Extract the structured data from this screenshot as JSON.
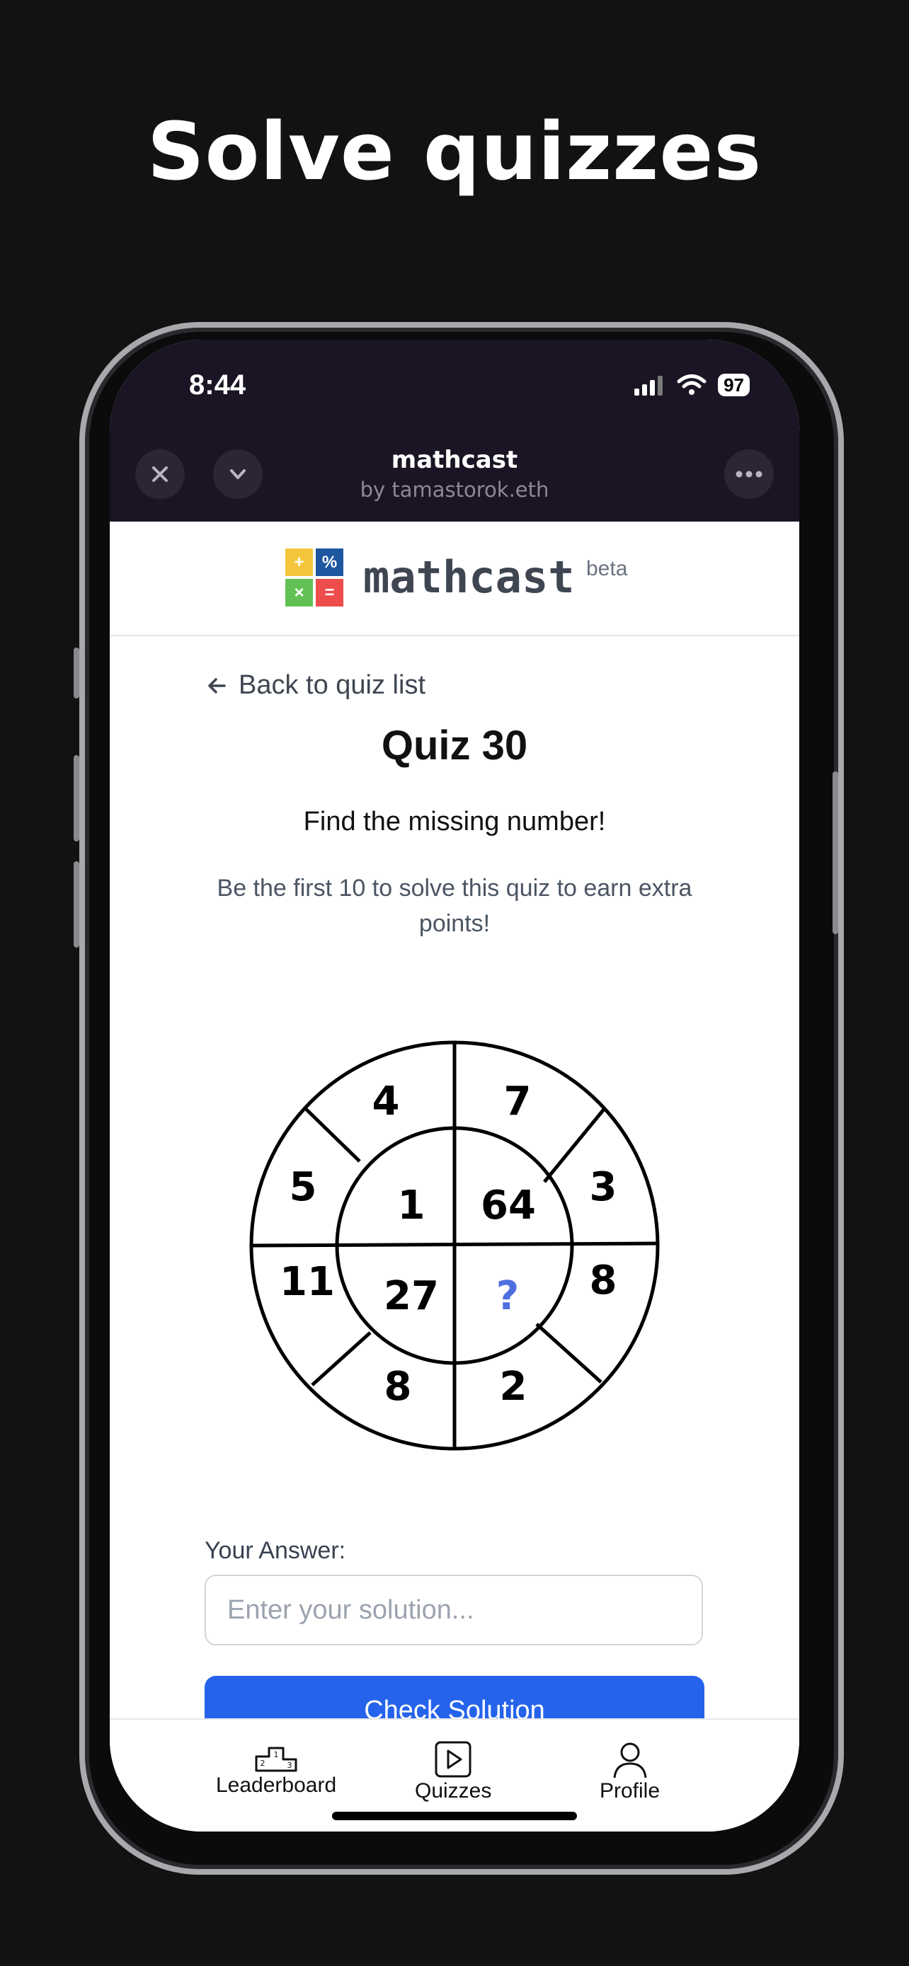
{
  "headline": "Solve quizzes",
  "status_bar": {
    "time": "8:44",
    "battery": "97"
  },
  "miniapp": {
    "title": "mathcast",
    "subtitle": "by tamastorok.eth"
  },
  "site": {
    "brand": "mathcast",
    "badge": "beta",
    "logo_symbols": [
      "+",
      "%",
      "×",
      "="
    ],
    "logo_colors": [
      "#f5c63c",
      "#1e56a0",
      "#62c154",
      "#ef4c4c"
    ]
  },
  "quiz": {
    "back_label": "Back to quiz list",
    "title": "Quiz 30",
    "prompt": "Find the missing number!",
    "subprompt": "Be the first 10 to solve this quiz to earn extra points!",
    "outer_numbers": [
      "4",
      "7",
      "5",
      "3",
      "11",
      "8",
      "8",
      "2"
    ],
    "inner_numbers": [
      "1",
      "64",
      "27",
      "?"
    ]
  },
  "answer": {
    "label": "Your Answer:",
    "placeholder": "Enter your solution...",
    "value": "",
    "submit_label": "Check Solution"
  },
  "bottom_nav": [
    {
      "label": "Leaderboard",
      "icon": "podium-icon"
    },
    {
      "label": "Quizzes",
      "icon": "play-square-icon"
    },
    {
      "label": "Profile",
      "icon": "user-icon"
    }
  ],
  "colors": {
    "accent": "#2563eb",
    "question_mark": "#4f6fe0"
  }
}
